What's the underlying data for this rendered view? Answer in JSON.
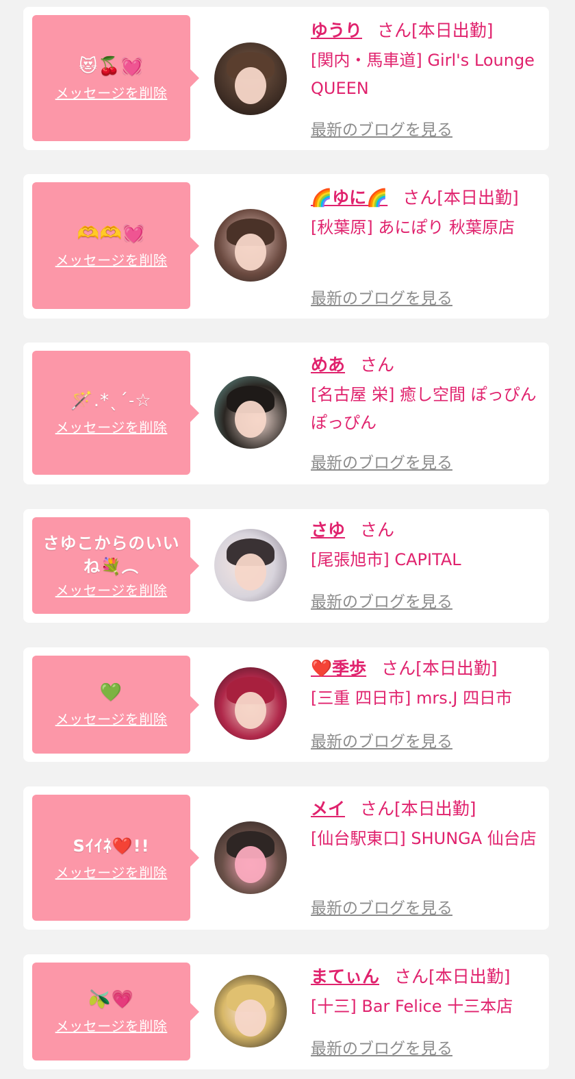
{
  "delete_label": "メッセージを削除",
  "san_label": "さん",
  "blog_label": "最新のブログを見る",
  "colors": {
    "accent": "#e0226d",
    "bubble": "#fc97a8",
    "card": "#ffffff",
    "page": "#f2f2f2",
    "link_gray": "#8c8c8c"
  },
  "entries": [
    {
      "message": "😻🍒💓",
      "name": "ゆうり",
      "status": "[本日出勤]",
      "shop": "[関内・馬車道] Girl's Lounge QUEEN"
    },
    {
      "message": "🫶🫶💓",
      "name": "🌈ゆに🌈",
      "status": "[本日出勤]",
      "shop": "[秋葉原] あにぽり 秋葉原店"
    },
    {
      "message": "🪄.*ˎˊ˗☆",
      "name": "めあ",
      "status": "",
      "shop": "[名古屋 栄] 癒し空間 ぽっぴんぽっぴん"
    },
    {
      "message": "さゆこからのいいね💐︵",
      "name": "さゆ",
      "status": "",
      "shop": "[尾張旭市] CAPITAL"
    },
    {
      "message": "💚",
      "name": "❤️季歩",
      "status": "[本日出勤]",
      "shop": "[三重 四日市] mrs.J 四日市"
    },
    {
      "message": "Sｲｲﾈ❤️!!",
      "name": "メイ",
      "status": "[本日出勤]",
      "shop": "[仙台駅東口] SHUNGA 仙台店"
    },
    {
      "message": "🫒💗",
      "name": "まてぃん",
      "status": "[本日出勤]",
      "shop": "[十三] Bar Felice 十三本店"
    }
  ]
}
